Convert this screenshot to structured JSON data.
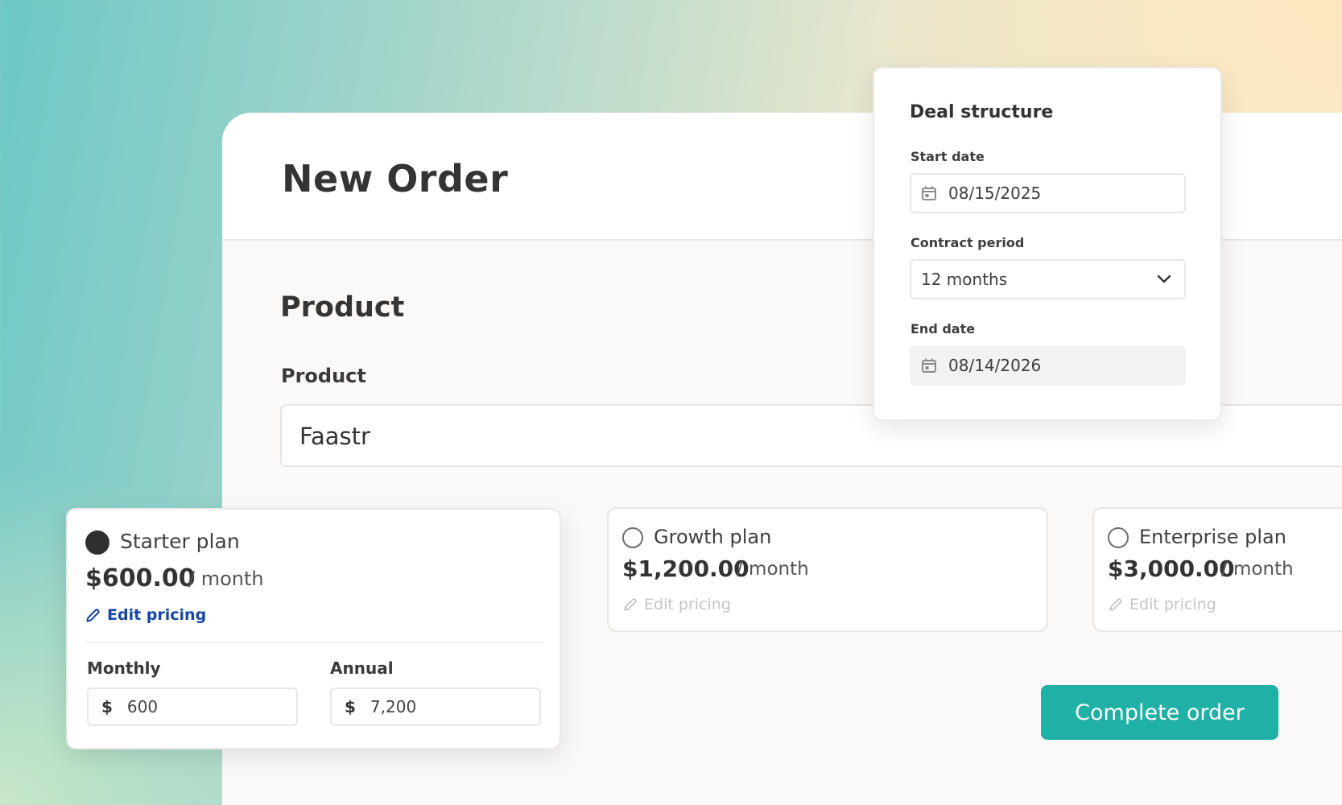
{
  "main": {
    "title": "New Order",
    "section_title": "Product",
    "product_label": "Product",
    "product_value": "Faastr"
  },
  "plans": [
    {
      "name": "Starter plan",
      "price": "$600.00",
      "unit": "/ month",
      "edit_label": "Edit pricing",
      "selected": true,
      "monthly_label": "Monthly",
      "monthly_currency": "$",
      "monthly_value": "600",
      "annual_label": "Annual",
      "annual_currency": "$",
      "annual_value": "7,200"
    },
    {
      "name": "Growth plan",
      "price": "$1,200.00",
      "unit": "/ month",
      "edit_label": "Edit pricing",
      "selected": false
    },
    {
      "name": "Enterprise plan",
      "price": "$3,000.00",
      "unit": "/ month",
      "edit_label": "Edit pricing",
      "selected": false
    }
  ],
  "deal": {
    "title": "Deal structure",
    "start_label": "Start date",
    "start_value": "08/15/2025",
    "period_label": "Contract period",
    "period_value": "12 months",
    "end_label": "End date",
    "end_value": "08/14/2026"
  },
  "actions": {
    "complete_label": "Complete order"
  },
  "colors": {
    "accent": "#1fb0a6",
    "link": "#1546a8",
    "disabled": "#c4c4c4"
  },
  "icons": {
    "pencil": "pencil-icon",
    "calendar": "calendar-icon",
    "chevron": "chevron-down-icon"
  }
}
